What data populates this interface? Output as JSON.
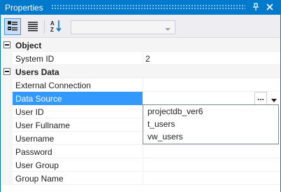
{
  "window": {
    "title": "Properties"
  },
  "toolbar": {
    "combo_value": ""
  },
  "categories": [
    {
      "label": "Object",
      "rows": [
        {
          "name": "System ID",
          "value": "2"
        }
      ]
    },
    {
      "label": "Users Data",
      "rows": [
        {
          "name": "External Connection",
          "value": ""
        },
        {
          "name": "Data Source",
          "value": ""
        },
        {
          "name": "User ID",
          "value": ""
        },
        {
          "name": "User Fullname",
          "value": ""
        },
        {
          "name": "Username",
          "value": ""
        },
        {
          "name": "Password",
          "value": ""
        },
        {
          "name": "User Group",
          "value": ""
        },
        {
          "name": "Group Name",
          "value": ""
        }
      ]
    }
  ],
  "editor": {
    "ellipsis_label": "..."
  },
  "dropdown": {
    "options": [
      "projectdb_ver6",
      "t_users",
      "vw_users"
    ]
  },
  "colors": {
    "accent": "#007acc",
    "selection": "#3399ff"
  }
}
